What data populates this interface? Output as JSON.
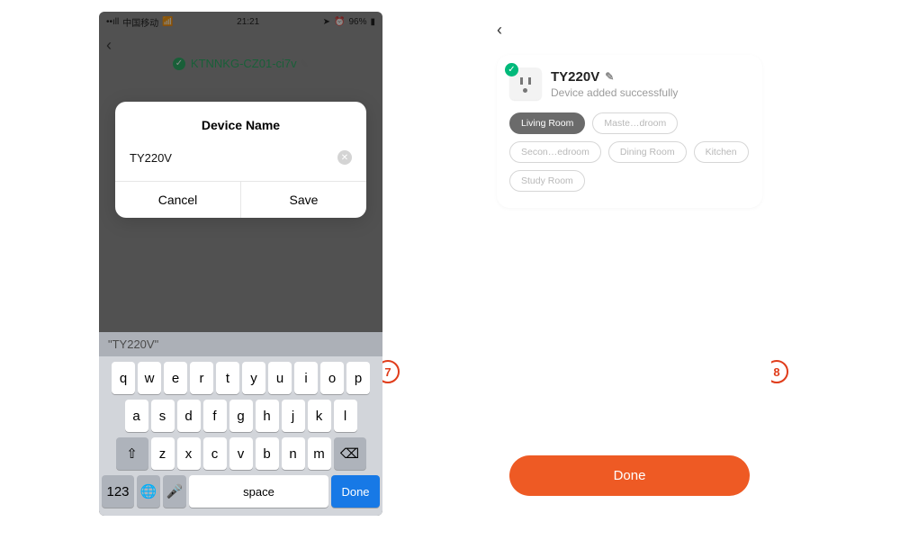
{
  "step7": "7",
  "step8": "8",
  "left": {
    "status": {
      "carrier": "中国移动",
      "time": "21:21",
      "battery": "96%"
    },
    "behind_device": "KTNNKG-CZ01-ci7v",
    "dialog": {
      "title": "Device Name",
      "value": "TY220V",
      "cancel": "Cancel",
      "save": "Save"
    },
    "suggestion": "\"TY220V\"",
    "keyboard": {
      "row1": [
        "q",
        "w",
        "e",
        "r",
        "t",
        "y",
        "u",
        "i",
        "o",
        "p"
      ],
      "row2": [
        "a",
        "s",
        "d",
        "f",
        "g",
        "h",
        "j",
        "k",
        "l"
      ],
      "row3": [
        "z",
        "x",
        "c",
        "v",
        "b",
        "n",
        "m"
      ],
      "shift": "⇧",
      "del": "⌫",
      "num": "123",
      "globe": "🌐",
      "mic": "🎤",
      "space": "space",
      "done": "Done"
    }
  },
  "right": {
    "device": {
      "name": "TY220V",
      "subtitle": "Device added successfully"
    },
    "rooms": [
      "Living Room",
      "Maste…droom",
      "Secon…edroom",
      "Dining Room",
      "Kitchen",
      "Study Room"
    ],
    "selected_room": 0,
    "done": "Done"
  }
}
